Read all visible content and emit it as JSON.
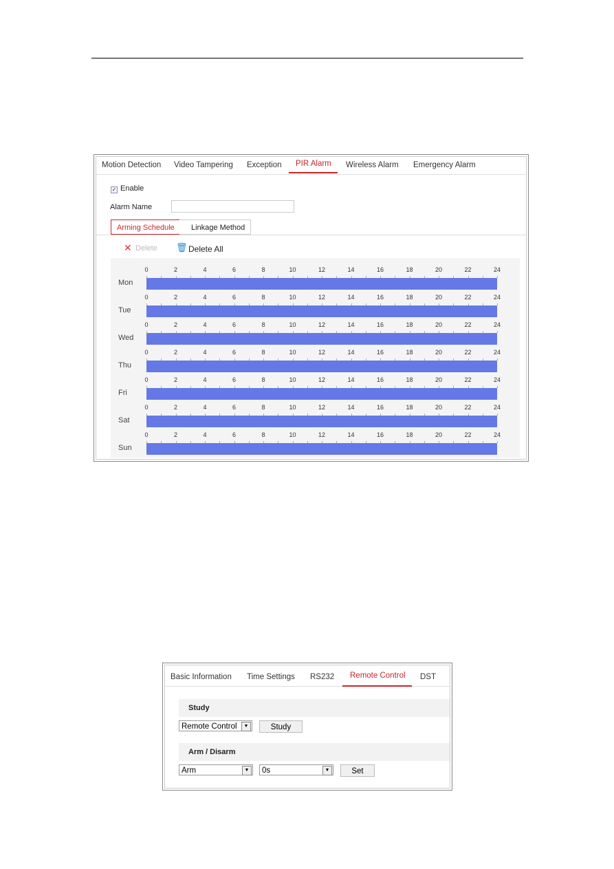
{
  "pir_panel": {
    "tabs": [
      "Motion Detection",
      "Video Tampering",
      "Exception",
      "PIR Alarm",
      "Wireless Alarm",
      "Emergency Alarm"
    ],
    "active_tab": "PIR Alarm",
    "enable_label": "Enable",
    "enable_checked": true,
    "alarm_name_label": "Alarm Name",
    "alarm_name_value": "",
    "subtabs": [
      "Arming Schedule",
      "Linkage Method"
    ],
    "active_subtab": "Arming Schedule",
    "delete_label": "Delete",
    "delete_all_label": "Delete All",
    "hour_ticks": [
      "0",
      "2",
      "4",
      "6",
      "8",
      "10",
      "12",
      "14",
      "16",
      "18",
      "20",
      "22",
      "24"
    ],
    "days": [
      {
        "label": "Mon",
        "start": 0,
        "end": 24
      },
      {
        "label": "Tue",
        "start": 0,
        "end": 24
      },
      {
        "label": "Wed",
        "start": 0,
        "end": 24
      },
      {
        "label": "Thu",
        "start": 0,
        "end": 24
      },
      {
        "label": "Fri",
        "start": 0,
        "end": 24
      },
      {
        "label": "Sat",
        "start": 0,
        "end": 24
      },
      {
        "label": "Sun",
        "start": 0,
        "end": 24
      }
    ],
    "schedule_color": "#6478e6",
    "accent_color": "#c8252c"
  },
  "remote_panel": {
    "tabs": [
      "Basic Information",
      "Time Settings",
      "RS232",
      "Remote Control",
      "DST"
    ],
    "active_tab": "Remote Control",
    "study_section": "Study",
    "study_select_value": "Remote Control",
    "study_button": "Study",
    "arm_section": "Arm / Disarm",
    "arm_select_value": "Arm",
    "delay_select_value": "0s",
    "set_button": "Set"
  }
}
